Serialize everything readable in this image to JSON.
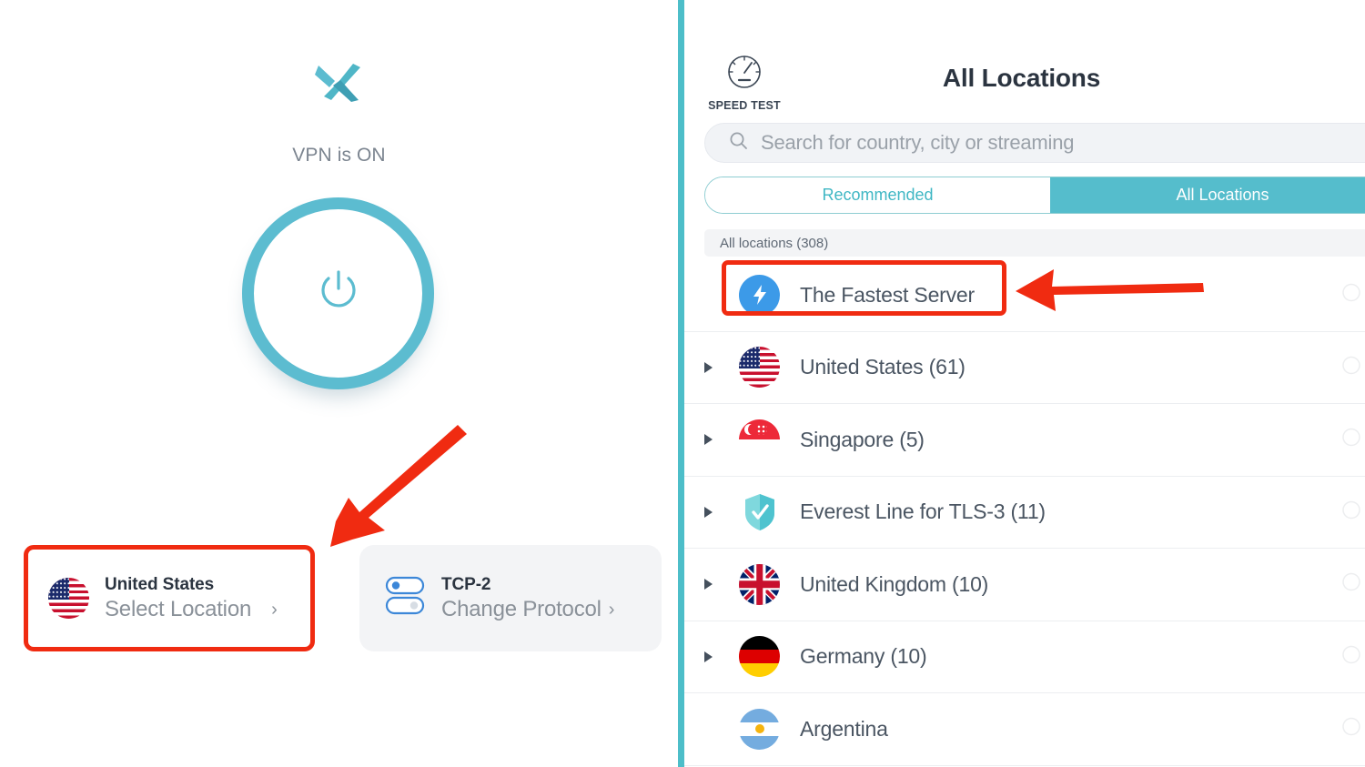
{
  "app": {
    "logo_icon": "x-logo-icon",
    "accent_teal": "#55bdcc",
    "annotation_red": "#f02b11"
  },
  "left_panel": {
    "status_text": "VPN is ON",
    "power_button": {
      "icon": "power-icon",
      "state": "on"
    },
    "location_card": {
      "flag_icon": "flag-united-states-icon",
      "title": "United States",
      "subtitle": "Select Location",
      "chevron": "›",
      "highlighted": true
    },
    "protocol_card": {
      "icon": "protocol-toggles-icon",
      "title": "TCP-2",
      "subtitle": "Change Protocol",
      "chevron": "›"
    }
  },
  "right_panel": {
    "speed_test": {
      "icon": "speedometer-icon",
      "label": "SPEED TEST"
    },
    "title": "All Locations",
    "search": {
      "icon": "search-icon",
      "placeholder": "Search for country, city or streaming",
      "value": ""
    },
    "tabs": [
      {
        "label": "Recommended",
        "active": false
      },
      {
        "label": "All Locations",
        "active": true
      }
    ],
    "section_header": "All locations (308)",
    "list": [
      {
        "label": "The Fastest Server",
        "icon": "lightning-bolt-icon",
        "expandable": false,
        "highlighted": true
      },
      {
        "label": "United States (61)",
        "icon": "flag-united-states-icon",
        "expandable": true,
        "highlighted": false
      },
      {
        "label": "Singapore (5)",
        "icon": "flag-singapore-icon",
        "expandable": true,
        "highlighted": false
      },
      {
        "label": "Everest Line for TLS-3 (11)",
        "icon": "shield-check-icon",
        "expandable": true,
        "highlighted": false
      },
      {
        "label": "United Kingdom (10)",
        "icon": "flag-united-kingdom-icon",
        "expandable": true,
        "highlighted": false
      },
      {
        "label": "Germany (10)",
        "icon": "flag-germany-icon",
        "expandable": true,
        "highlighted": false
      },
      {
        "label": "Argentina",
        "icon": "flag-argentina-icon",
        "expandable": false,
        "highlighted": false
      }
    ]
  },
  "annotations": {
    "arrow_to_location_card": "red-arrow-down-left",
    "arrow_to_fastest_server": "red-arrow-left",
    "box_location_card": "red-highlight-box",
    "box_fastest_server": "red-highlight-box"
  }
}
